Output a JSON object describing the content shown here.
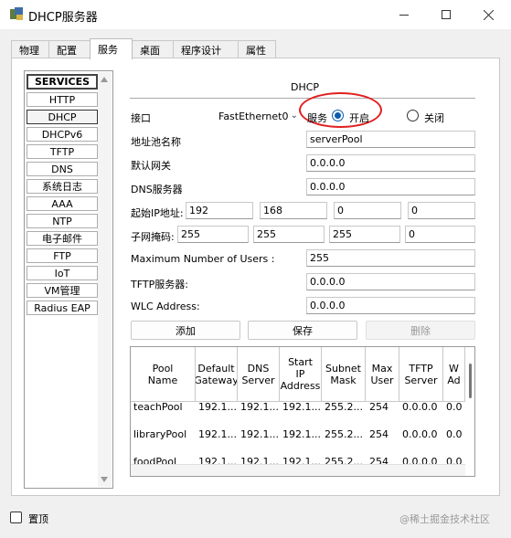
{
  "window": {
    "title": "DHCP服务器"
  },
  "tabs": [
    "物理",
    "配置",
    "服务",
    "桌面",
    "程序设计",
    "属性"
  ],
  "services": {
    "header": "SERVICES",
    "items": [
      "HTTP",
      "DHCP",
      "DHCPv6",
      "TFTP",
      "DNS",
      "系统日志",
      "AAA",
      "NTP",
      "电子邮件",
      "FTP",
      "IoT",
      "VM管理",
      "Radius EAP"
    ]
  },
  "dhcp": {
    "title": "DHCP",
    "interface_label": "接口",
    "interface_value": "FastEthernet0",
    "service_label": "服务",
    "on_label": "开启",
    "off_label": "关闭",
    "pool_name_label": "地址池名称",
    "pool_name_value": "serverPool",
    "gateway_label": "默认网关",
    "gateway_value": "0.0.0.0",
    "dns_label": "DNS服务器",
    "dns_value": "0.0.0.0",
    "start_ip_label": "起始IP地址:",
    "start_ip": [
      "192",
      "168",
      "0",
      "0"
    ],
    "mask_label": "子网掩码:",
    "mask": [
      "255",
      "255",
      "255",
      "0"
    ],
    "max_users_label": "Maximum Number of Users :",
    "max_users_value": "255",
    "tftp_label": "TFTP服务器:",
    "tftp_value": "0.0.0.0",
    "wlc_label": "WLC Address:",
    "wlc_value": "0.0.0.0",
    "add_button": "添加",
    "save_button": "保存",
    "delete_button": "删除"
  },
  "table": {
    "headers": [
      "Pool\nName",
      "Default\nGateway",
      "DNS\nServer",
      "Start\nIP\nAddress",
      "Subnet\nMask",
      "Max\nUser",
      "TFTP\nServer",
      "W\nAd"
    ],
    "rows": [
      [
        "teachPool",
        "192.1...",
        "192.1...",
        "192.1...",
        "255.2...",
        "254",
        "0.0.0.0",
        "0.0"
      ],
      [
        "libraryPool",
        "192.1...",
        "192.1...",
        "192.1...",
        "255.2...",
        "254",
        "0.0.0.0",
        "0.0"
      ],
      [
        "foodPool",
        "192.1...",
        "192.1...",
        "192.1...",
        "255.2...",
        "254",
        "0.0.0.0",
        "0.0"
      ]
    ]
  },
  "footer": {
    "top_label": "置顶",
    "watermark": "@稀土掘金技术社区"
  },
  "colors": {
    "accent": "#0b5cad",
    "highlight": "#e02020"
  }
}
